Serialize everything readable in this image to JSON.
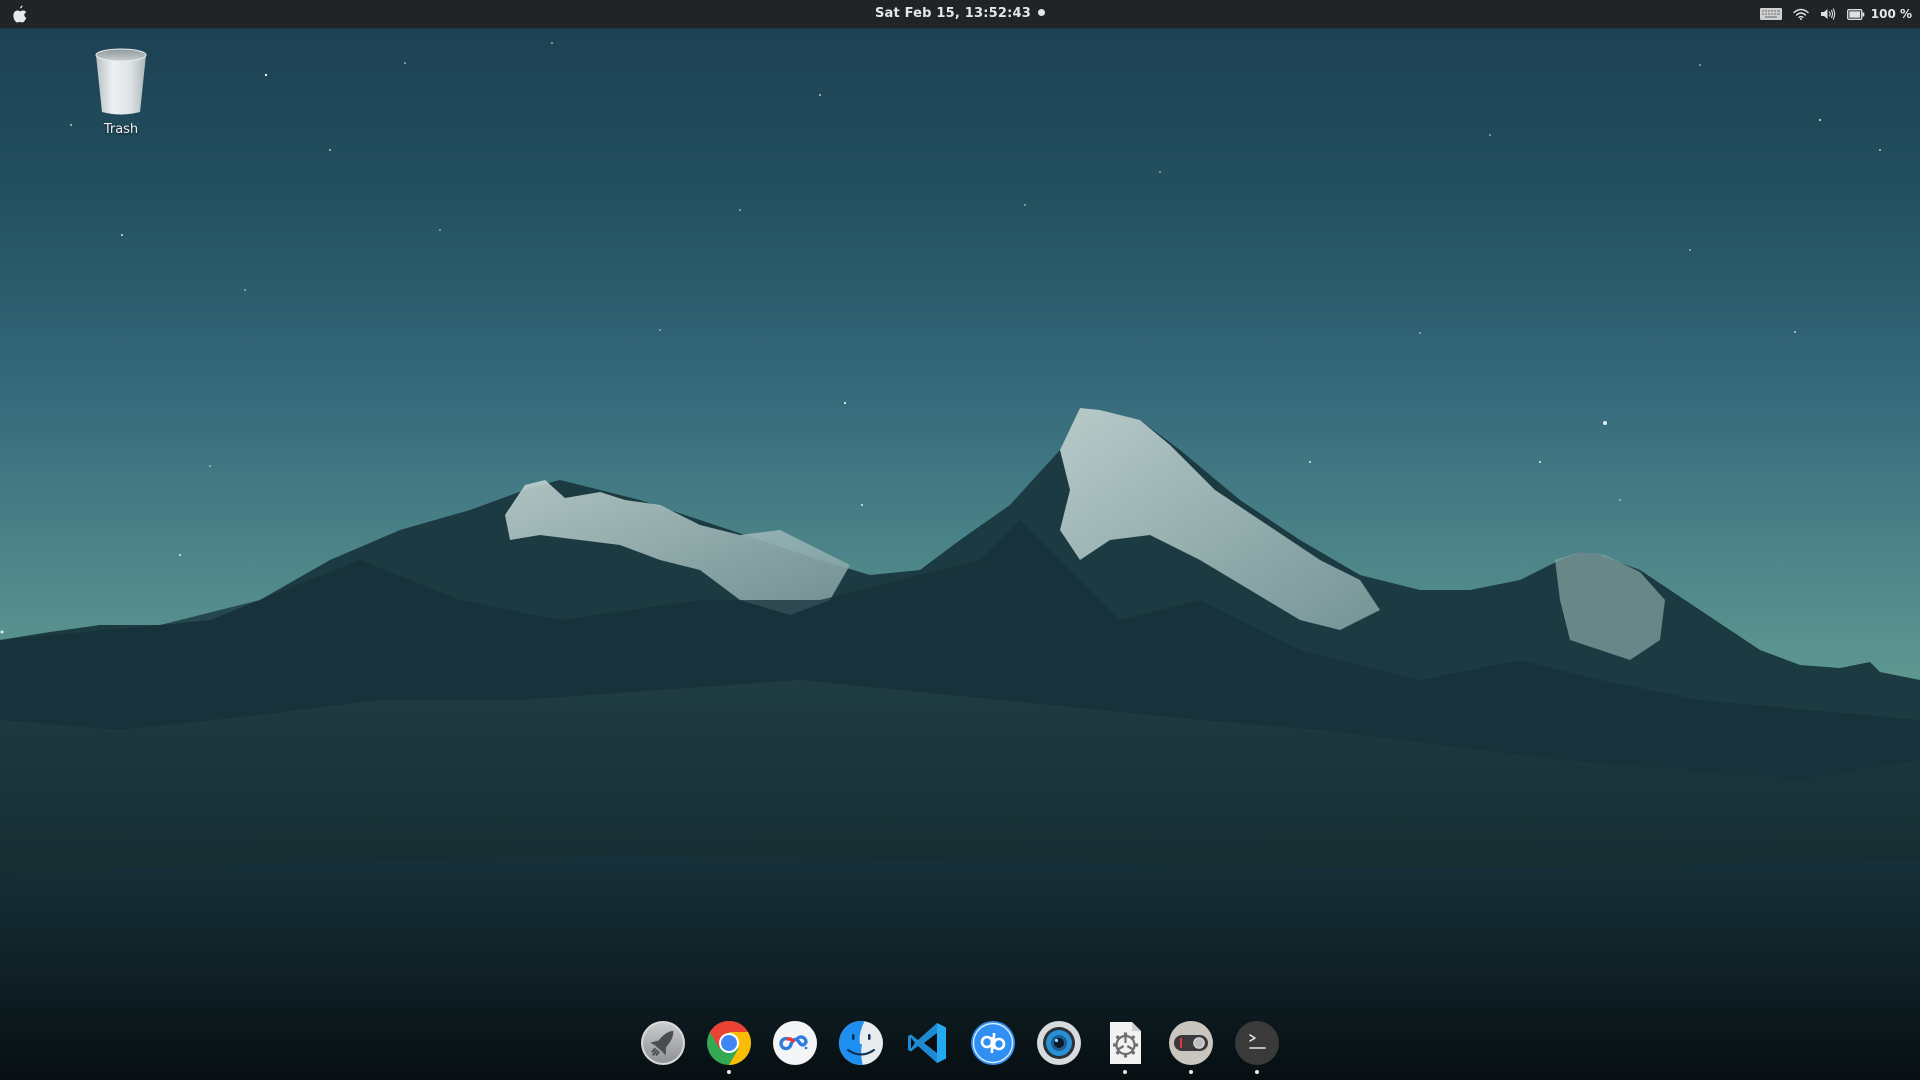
{
  "topbar": {
    "apple_menu": "apple-menu",
    "clock": "Sat Feb 15, 13:52:43",
    "notification_dot": true,
    "tray": {
      "keyboard": "keyboard-layout-icon",
      "wifi": "wifi-icon",
      "volume": "volume-icon",
      "battery": "battery-icon",
      "battery_percent": "100 %"
    }
  },
  "desktop": {
    "icons": [
      {
        "label": "Trash",
        "icon": "trash-icon"
      }
    ],
    "wallpaper": "night sky over snow-capped mountains with fog"
  },
  "dock": {
    "items": [
      {
        "name": "Launchpad",
        "icon": "rocket-icon",
        "running": false
      },
      {
        "name": "Google Chrome",
        "icon": "chrome-icon",
        "running": true
      },
      {
        "name": "Baidu Netdisk",
        "icon": "cloud-sync-icon",
        "running": false
      },
      {
        "name": "Finder",
        "icon": "finder-icon",
        "running": false
      },
      {
        "name": "Visual Studio Code",
        "icon": "vscode-icon",
        "running": false
      },
      {
        "name": "qBittorrent",
        "icon": "qbittorrent-icon",
        "running": false
      },
      {
        "name": "Camera",
        "icon": "camera-lens-icon",
        "running": false
      },
      {
        "name": "Settings File",
        "icon": "settings-file-icon",
        "running": true
      },
      {
        "name": "Toggle App",
        "icon": "toggle-switch-icon",
        "running": true
      },
      {
        "name": "Terminal",
        "icon": "terminal-icon",
        "running": true
      }
    ]
  },
  "colors": {
    "topbar_bg": "#202427",
    "sky_top": "#1b3f52",
    "sky_horizon": "#6aa29a",
    "vscode_blue": "#23a9f2",
    "qbittorrent_blue": "#2f8ff2"
  }
}
